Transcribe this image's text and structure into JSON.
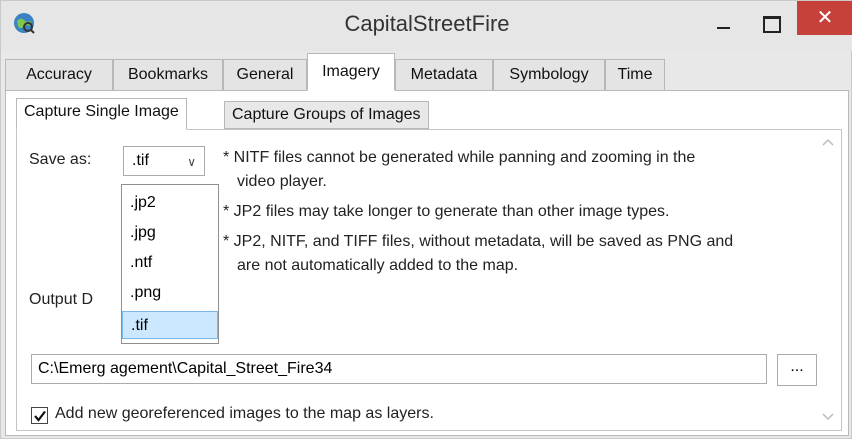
{
  "window": {
    "title": "CapitalStreetFire",
    "close_glyph": "✕"
  },
  "tabs": [
    {
      "label": "Accuracy"
    },
    {
      "label": "Bookmarks"
    },
    {
      "label": "General"
    },
    {
      "label": "Imagery"
    },
    {
      "label": "Metadata"
    },
    {
      "label": "Symbology"
    },
    {
      "label": "Time"
    }
  ],
  "active_tab": "Imagery",
  "subtabs": [
    {
      "label": "Capture Single Image"
    },
    {
      "label": "Capture Groups of Images"
    }
  ],
  "save_as": {
    "label": "Save as:",
    "selected": ".tif",
    "options": [
      ".jp2",
      ".jpg",
      ".ntf",
      ".png",
      ".tif"
    ]
  },
  "notes": {
    "n1_line1": "* NITF files cannot be generated while panning and zooming in the",
    "n1_line2": "video player.",
    "n2": "* JP2 files may take longer to generate than other image types.",
    "n3_line1": "* JP2, NITF, and TIFF files, without metadata, will be saved as PNG and",
    "n3_line2": "are not automatically added to the map."
  },
  "output": {
    "label": "Output D",
    "path": "C:\\Emerg      agement\\Capital_Street_Fire34",
    "browse_label": "..."
  },
  "checkbox": {
    "checked": true,
    "label": "Add new georeferenced images to the map as layers."
  },
  "colors": {
    "close_button": "#c7413b",
    "selection": "#cce8ff"
  }
}
